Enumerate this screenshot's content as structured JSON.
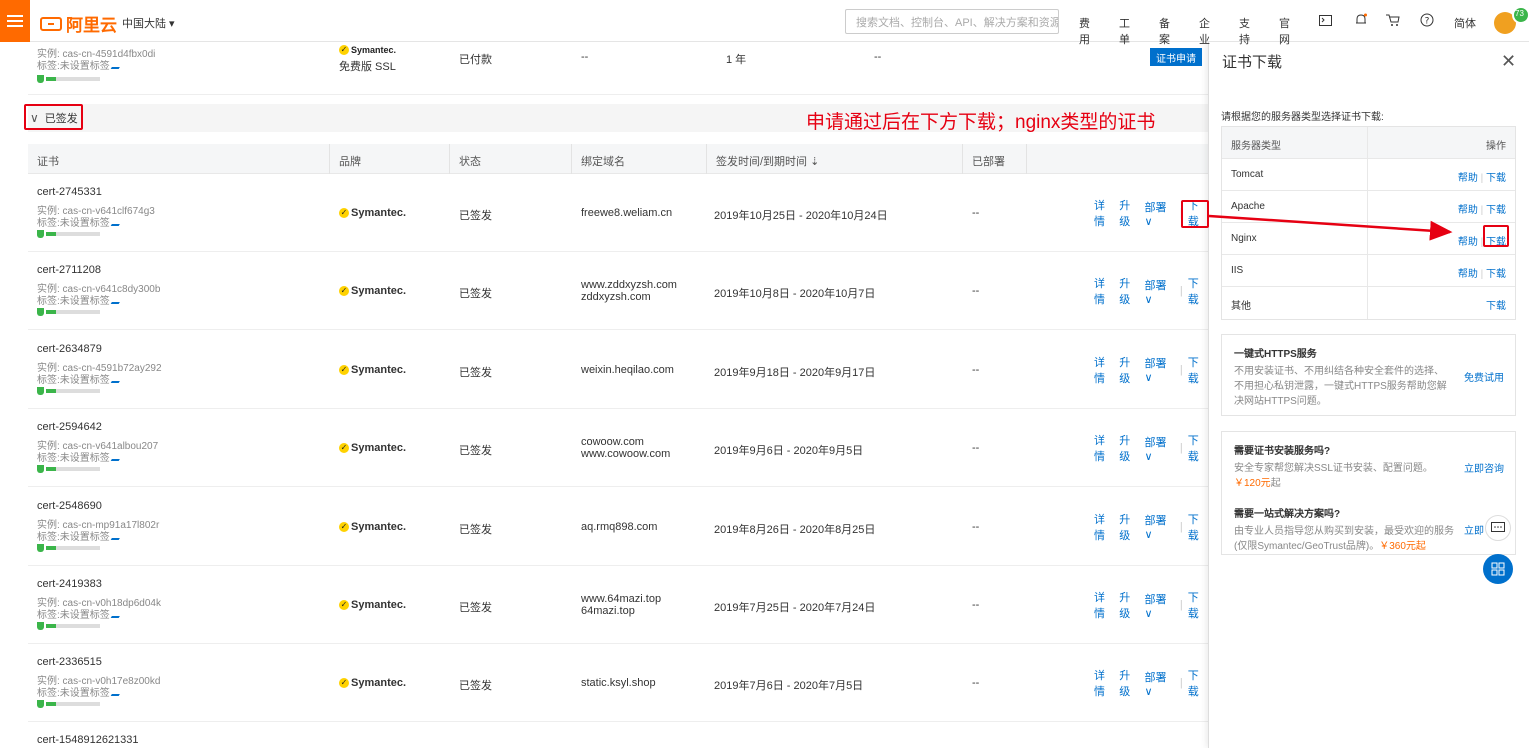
{
  "header": {
    "logo_text": "阿里云",
    "region": "中国大陆 ▾",
    "search_placeholder": "搜索文档、控制台、API、解决方案和资源",
    "nav": [
      "费用",
      "工单",
      "备案",
      "企业",
      "支持",
      "官网"
    ],
    "lang": "简体",
    "avatar_text": "73"
  },
  "top_row": {
    "instance": "实例: cas-cn-4591d4fbx0di",
    "tag": "标签:未设置标签",
    "brand": "Symantec.",
    "brand_sub": "免费版 SSL",
    "status": "已付款",
    "domain": "--",
    "duration": "1 年",
    "deploy": "--",
    "apply_button": "证书申请"
  },
  "section_label": "已签发",
  "annotation": "申请通过后在下方下载；nginx类型的证书",
  "table": {
    "headers": [
      "证书",
      "品牌",
      "状态",
      "绑定域名",
      "签发时间/到期时间 ⇣",
      "已部署"
    ],
    "brand": "Symantec.",
    "actions": [
      "详情",
      "升级",
      "部署 ∨",
      "下载"
    ],
    "rows": [
      {
        "id": "cert-2745331",
        "instance": "实例: cas-cn-v641clf674g3",
        "tag": "标签:未设置标签",
        "status": "已签发",
        "domain": [
          "freewe8.weliam.cn"
        ],
        "time": "2019年10月25日 - 2020年10月24日",
        "deployed": "--"
      },
      {
        "id": "cert-2711208",
        "instance": "实例: cas-cn-v641c8dy300b",
        "tag": "标签:未设置标签",
        "status": "已签发",
        "domain": [
          "www.zddxyzsh.com",
          "zddxyzsh.com"
        ],
        "time": "2019年10月8日 - 2020年10月7日",
        "deployed": "--"
      },
      {
        "id": "cert-2634879",
        "instance": "实例: cas-cn-4591b72ay292",
        "tag": "标签:未设置标签",
        "status": "已签发",
        "domain": [
          "weixin.heqilao.com"
        ],
        "time": "2019年9月18日 - 2020年9月17日",
        "deployed": "--"
      },
      {
        "id": "cert-2594642",
        "instance": "实例: cas-cn-v641albou207",
        "tag": "标签:未设置标签",
        "status": "已签发",
        "domain": [
          "cowoow.com",
          "www.cowoow.com"
        ],
        "time": "2019年9月6日 - 2020年9月5日",
        "deployed": "--"
      },
      {
        "id": "cert-2548690",
        "instance": "实例: cas-cn-mp91a17l802r",
        "tag": "标签:未设置标签",
        "status": "已签发",
        "domain": [
          "aq.rmq898.com"
        ],
        "time": "2019年8月26日 - 2020年8月25日",
        "deployed": "--"
      },
      {
        "id": "cert-2419383",
        "instance": "实例: cas-cn-v0h18dp6d04k",
        "tag": "标签:未设置标签",
        "status": "已签发",
        "domain": [
          "www.64mazi.top",
          "64mazi.top"
        ],
        "time": "2019年7月25日 - 2020年7月24日",
        "deployed": "--"
      },
      {
        "id": "cert-2336515",
        "instance": "实例: cas-cn-v0h17e8z00kd",
        "tag": "标签:未设置标签",
        "status": "已签发",
        "domain": [
          "static.ksyl.shop"
        ],
        "time": "2019年7月6日 - 2020年7月5日",
        "deployed": "--"
      }
    ],
    "last_id": "cert-1548912621331"
  },
  "panel": {
    "title": "证书下载",
    "hint": "请根据您的服务器类型选择证书下载:",
    "col_server": "服务器类型",
    "col_op": "操作",
    "servers": [
      {
        "name": "Tomcat",
        "help": "帮助",
        "download": "下载"
      },
      {
        "name": "Apache",
        "help": "帮助",
        "download": "下载"
      },
      {
        "name": "Nginx",
        "help": "帮助",
        "download": "下载"
      },
      {
        "name": "IIS",
        "help": "帮助",
        "download": "下载"
      },
      {
        "name": "其他",
        "help": "",
        "download": "下载"
      }
    ],
    "https_title": "一键式HTTPS服务",
    "https_desc": "不用安装证书、不用纠结各种安全套件的选择、不用担心私钥泄露，一键式HTTPS服务帮助您解决网站HTTPS问题。",
    "https_link": "免费试用",
    "svc_title": "需要证书安装服务吗?",
    "svc_desc": "安全专家帮您解决SSL证书安装、配置问题。",
    "svc_price": "￥120元",
    "svc_link": "立即咨询",
    "svc_desc_end": "起",
    "sol_title": "需要一站式解决方案吗?",
    "sol_desc": "由专业人员指导您从购买到安装，最受欢迎的服务(仅限Symantec/GeoTrust品牌)。",
    "sol_price": "￥360元起",
    "sol_link": "立即"
  }
}
